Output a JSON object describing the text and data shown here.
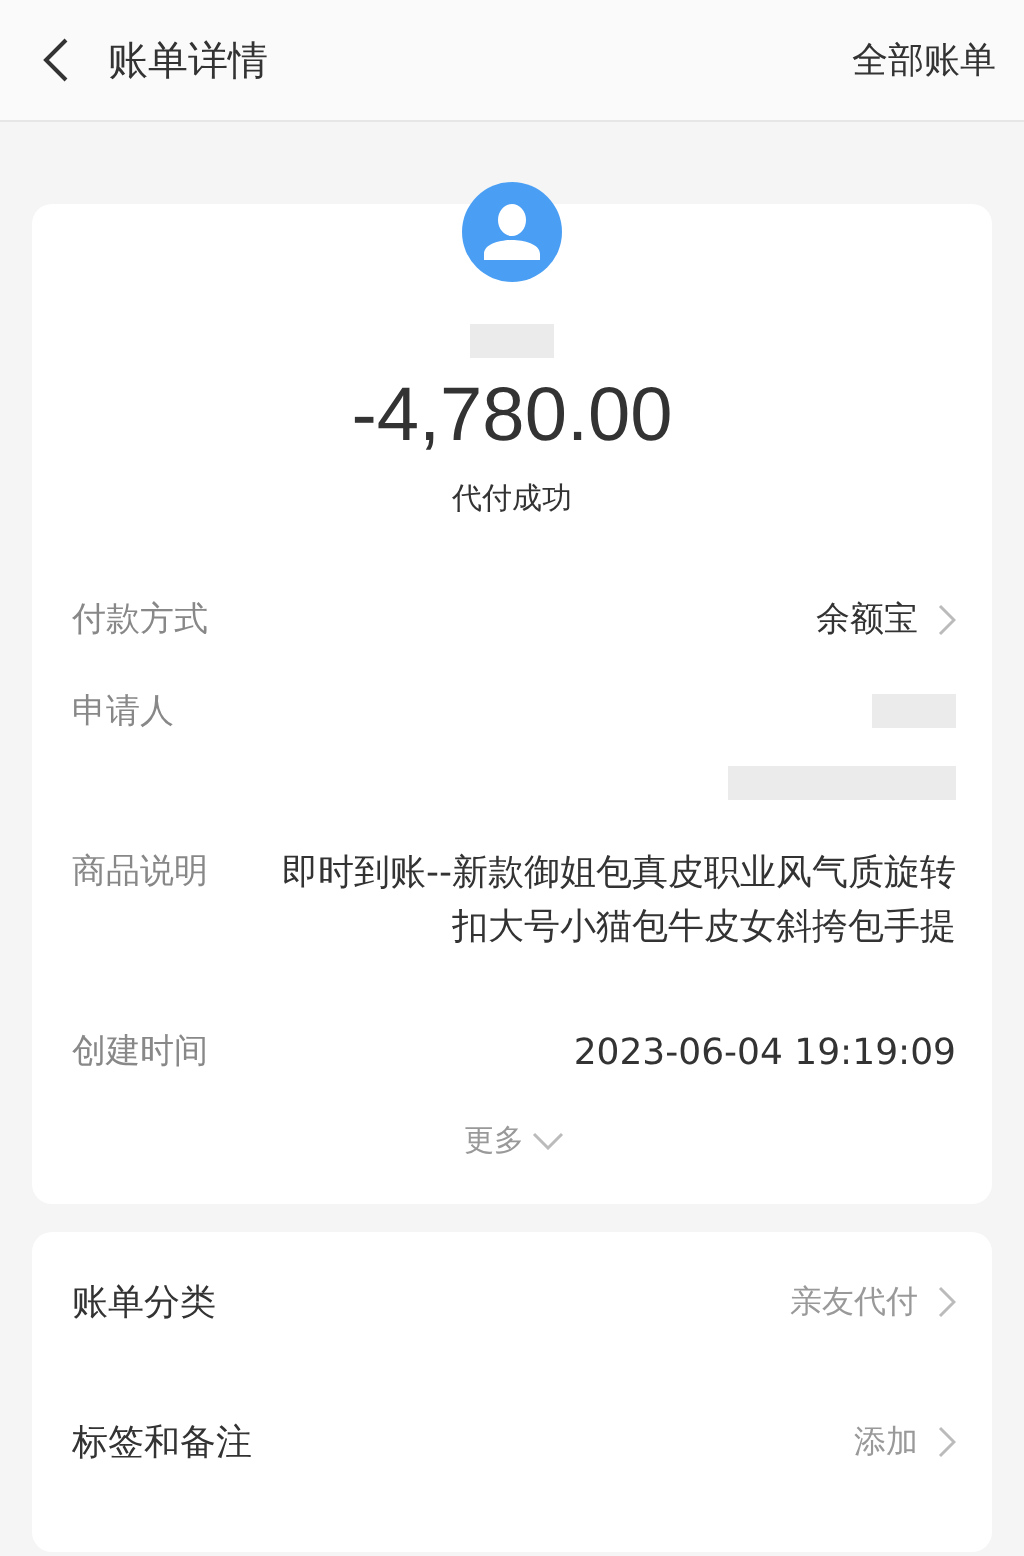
{
  "header": {
    "title": "账单详情",
    "action": "全部账单"
  },
  "summary": {
    "amount": "-4,780.00",
    "status": "代付成功"
  },
  "details": [
    {
      "kind": "link",
      "label": "付款方式",
      "value": "余额宝"
    },
    {
      "kind": "redacted",
      "label": "申请人"
    },
    {
      "kind": "redacted_wide"
    },
    {
      "kind": "text",
      "label": "商品说明",
      "value": "即时到账--新款御姐包真皮职业风气质旋转扣大号小猫包牛皮女斜挎包手提"
    },
    {
      "kind": "text",
      "label": "创建时间",
      "value": "2023-06-04 19:19:09"
    }
  ],
  "more": "更多",
  "options": [
    {
      "label": "账单分类",
      "value": "亲友代付"
    },
    {
      "label": "标签和备注",
      "value": "添加"
    }
  ]
}
